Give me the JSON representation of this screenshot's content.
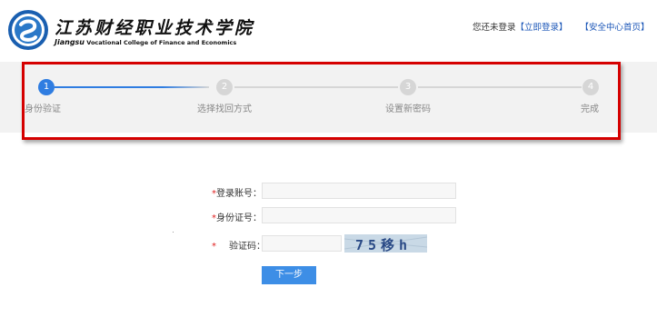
{
  "header": {
    "logo_cn": "江苏财经职业技术学院",
    "logo_en_lead": "Jiangsu",
    "logo_en_rest": "Vocational College of Finance and Economics",
    "not_logged_in": "您还未登录",
    "login_link": "【立即登录】",
    "security_home_link": "【安全中心首页】"
  },
  "steps": [
    {
      "number": "1",
      "label": "身份验证",
      "active": true
    },
    {
      "number": "2",
      "label": "选择找回方式",
      "active": false
    },
    {
      "number": "3",
      "label": "设置新密码",
      "active": false
    },
    {
      "number": "4",
      "label": "完成",
      "active": false
    }
  ],
  "form": {
    "required_mark": "*",
    "account_label": "登录账号：",
    "account_value": "",
    "id_label": "身份证号：",
    "id_value": "",
    "captcha_label": "验证码：",
    "captcha_value": "",
    "captcha_image_text": "75移h",
    "next_button": "下一步"
  },
  "colors": {
    "accent": "#2f7de1",
    "button": "#3d8ee6",
    "link": "#1c57b8",
    "highlight_border": "#d50000",
    "band": "#f2f2f2"
  }
}
